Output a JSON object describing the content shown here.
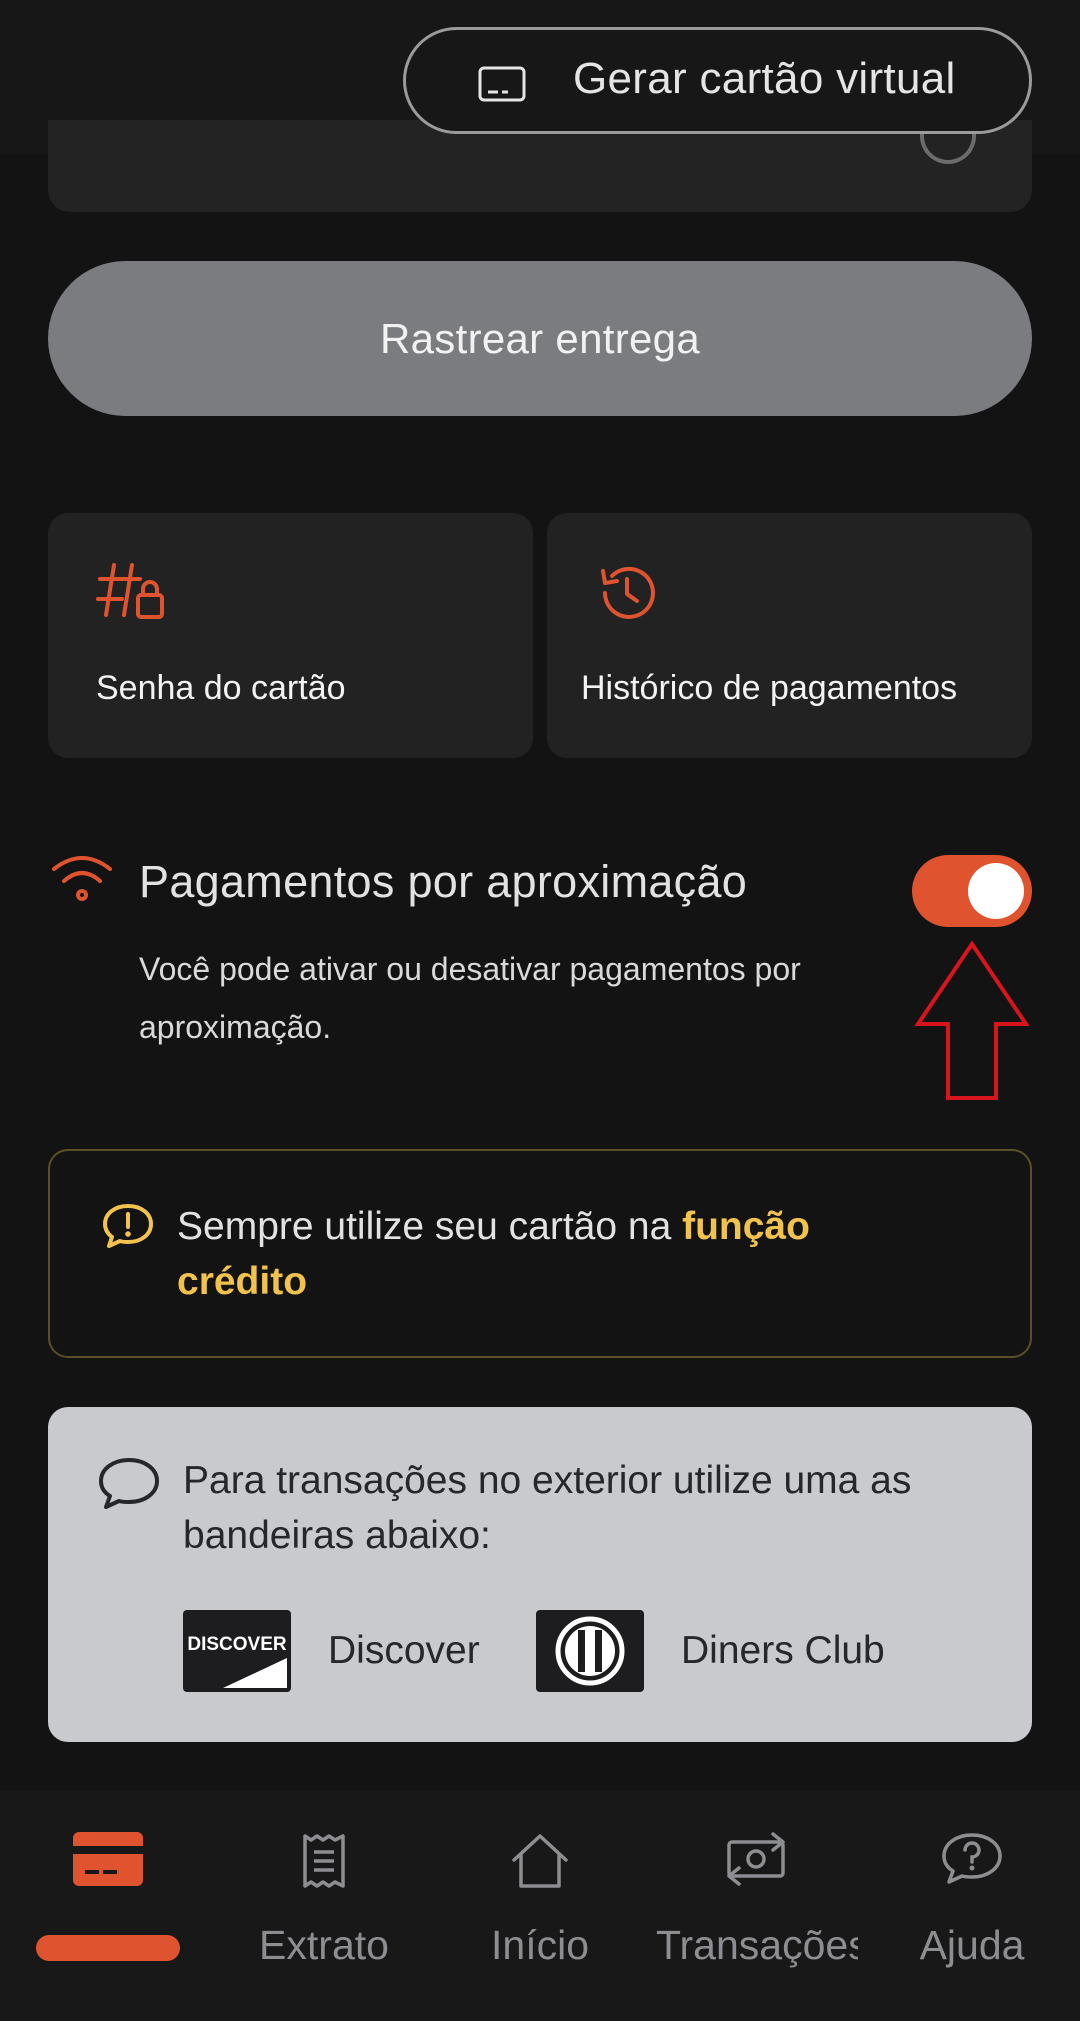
{
  "colors": {
    "background": "#131313",
    "accent": "#e0532f",
    "warning": "#f2c24f",
    "muted_button": "#7b7c80",
    "info_panel": "#c9cacd"
  },
  "header": {
    "virtual_card_label": "Gerar cartão virtual",
    "virtual_card_icon": "card-outline-icon"
  },
  "track_button": {
    "label": "Rastrear entrega"
  },
  "tiles": [
    {
      "label": "Senha do cartão",
      "icon": "hash-lock-icon"
    },
    {
      "label": "Histórico de pagamentos",
      "icon": "history-icon"
    }
  ],
  "contactless": {
    "title": "Pagamentos por aproximação",
    "description": "Você pode ativar ou desativar pagamentos por aproximação.",
    "enabled": true,
    "icon": "contactless-wifi-icon"
  },
  "notice": {
    "text": "Sempre utilize seu cartão na ",
    "highlight": "função crédito",
    "icon": "alert-bubble-icon"
  },
  "international": {
    "text": "Para transações no exterior utilize uma as bandeiras abaixo:",
    "icon": "chat-bubble-icon",
    "brands": [
      {
        "name": "Discover",
        "logo_text": "DISCOVER"
      },
      {
        "name": "Diners Club"
      }
    ]
  },
  "nav": {
    "items": [
      {
        "label": "",
        "icon": "card-icon",
        "active": true
      },
      {
        "label": "Extrato",
        "icon": "receipt-icon"
      },
      {
        "label": "Início",
        "icon": "home-icon"
      },
      {
        "label": "Transações",
        "icon": "money-transfer-icon"
      },
      {
        "label": "Ajuda",
        "icon": "help-bubble-icon"
      }
    ]
  }
}
